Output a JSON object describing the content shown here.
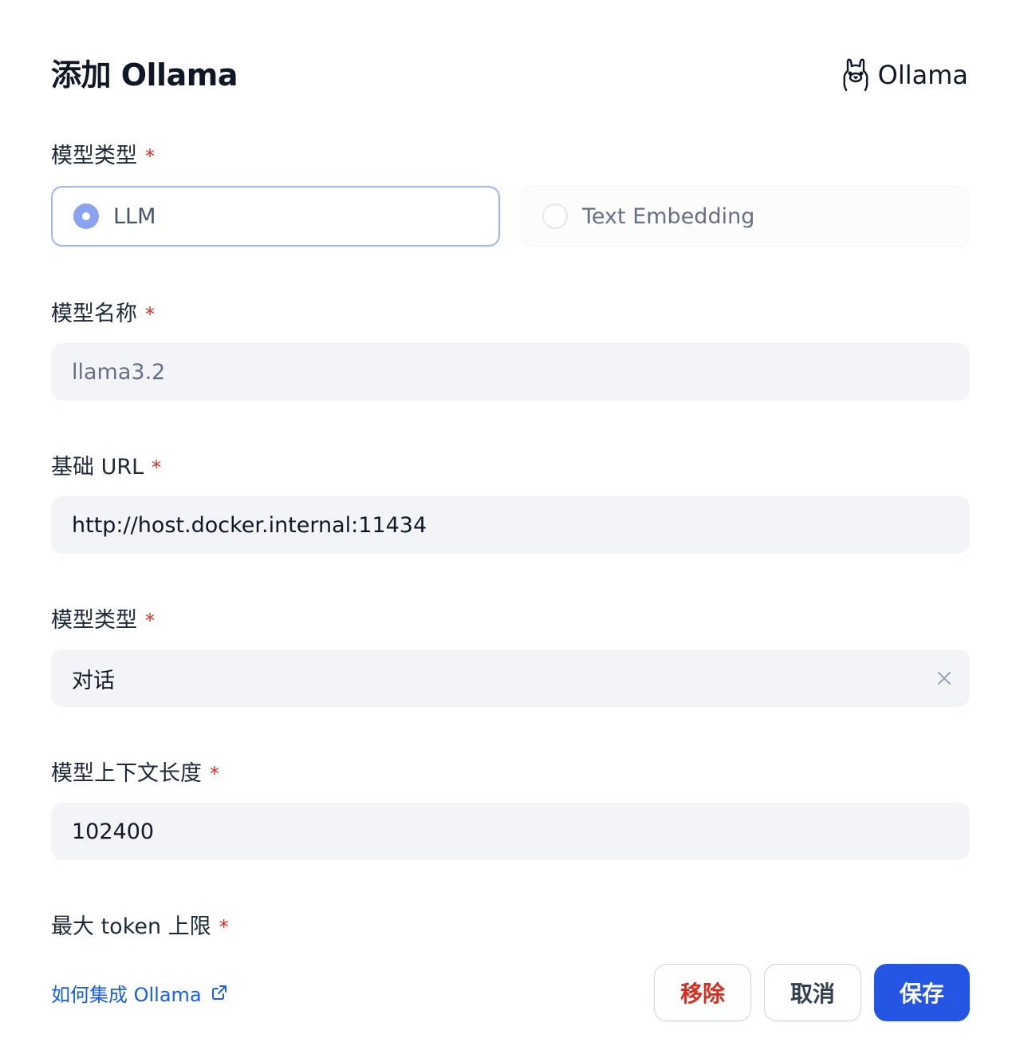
{
  "dialog": {
    "title": "添加 Ollama",
    "brand_name": "Ollama",
    "brand_icon": "ollama-llama-icon"
  },
  "fields": {
    "model_type": {
      "label": "模型类型",
      "required_mark": "*",
      "options": [
        {
          "label": "LLM",
          "selected": true
        },
        {
          "label": "Text Embedding",
          "selected": false
        }
      ]
    },
    "model_name": {
      "label": "模型名称",
      "required_mark": "*",
      "value": "",
      "placeholder": "llama3.2"
    },
    "base_url": {
      "label": "基础 URL",
      "required_mark": "*",
      "value": "http://host.docker.internal:11434"
    },
    "model_mode": {
      "label": "模型类型",
      "required_mark": "*",
      "value": "对话"
    },
    "context_length": {
      "label": "模型上下文长度",
      "required_mark": "*",
      "value": "102400"
    },
    "max_tokens": {
      "label": "最大 token 上限",
      "required_mark": "*"
    }
  },
  "footer": {
    "help_link": "如何集成 Ollama",
    "remove_label": "移除",
    "cancel_label": "取消",
    "save_label": "保存"
  },
  "colors": {
    "primary": "#2456e3",
    "danger": "#d92d20",
    "link": "#155eef",
    "radio_selected": "#8aa3f0",
    "input_bg": "#f2f4f7"
  }
}
